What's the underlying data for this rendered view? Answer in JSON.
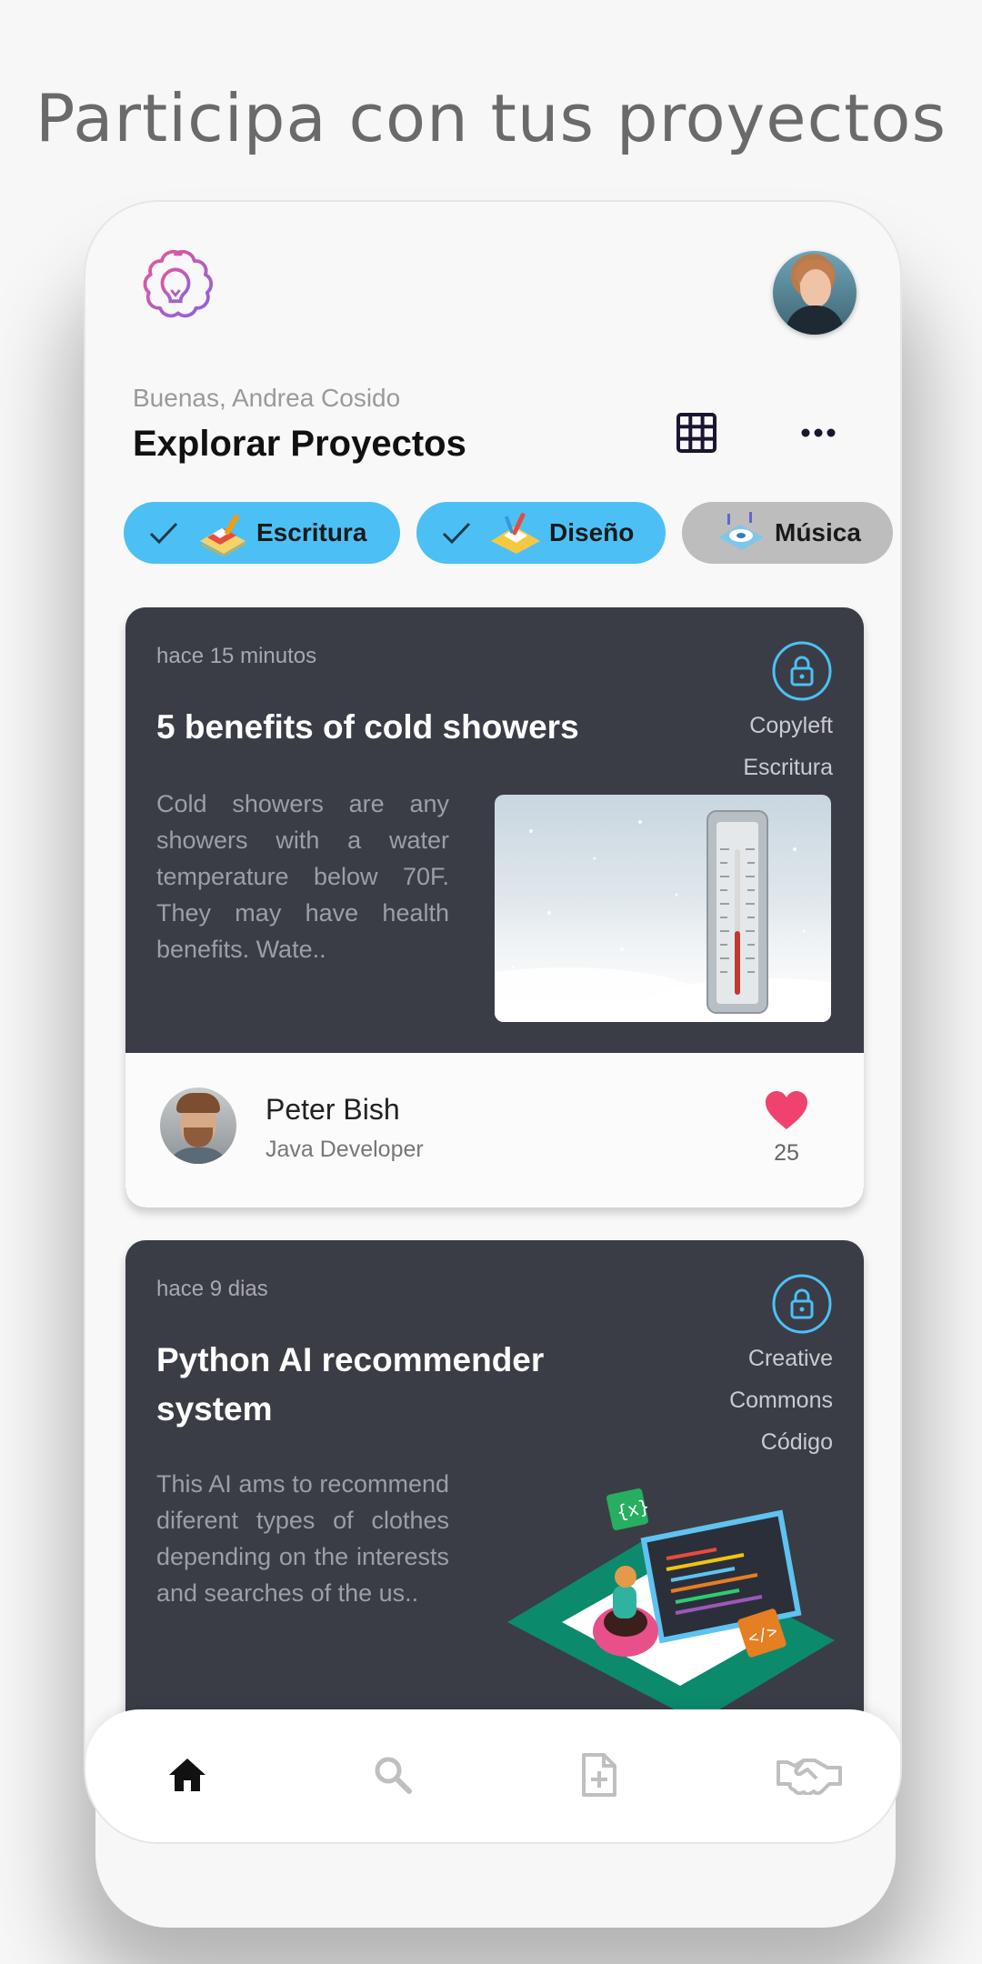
{
  "headline": "Participa con tus proyectos",
  "header": {
    "greeting": "Buenas, Andrea Cosido",
    "title": "Explorar Proyectos"
  },
  "chips": [
    {
      "label": "Escritura",
      "selected": true
    },
    {
      "label": "Diseño",
      "selected": true
    },
    {
      "label": "Música",
      "selected": false
    }
  ],
  "cards": [
    {
      "time": "hace 15 minutos",
      "title_lines": [
        "5 benefits of cold showers"
      ],
      "tags": [
        "Copyleft",
        "Escritura"
      ],
      "description": "Cold showers are any showers with a water temperature below 70F. They may have health benefits. Wate..",
      "author": {
        "name": "Peter Bish",
        "role": "Java Developer"
      },
      "likes": "25"
    },
    {
      "time": "hace 9 dias",
      "title_lines": [
        "Python AI recommender",
        "system"
      ],
      "tags": [
        "Creative",
        "Commons",
        "Código"
      ],
      "description": "This AI ams to recommend diferent types of clothes depending on the interests and searches of the us.."
    }
  ],
  "colors": {
    "accent": "#4cc0f4",
    "card_bg": "#3a3d45",
    "heart": "#f0426e",
    "lock": "#4cc0f4"
  },
  "icons": {
    "logo": "brain-lightbulb-icon",
    "grid": "grid-icon",
    "more": "more-dots-icon",
    "lock": "lock-icon",
    "like": "heart-icon",
    "nav": [
      "home-icon",
      "search-icon",
      "add-file-icon",
      "handshake-icon"
    ]
  }
}
